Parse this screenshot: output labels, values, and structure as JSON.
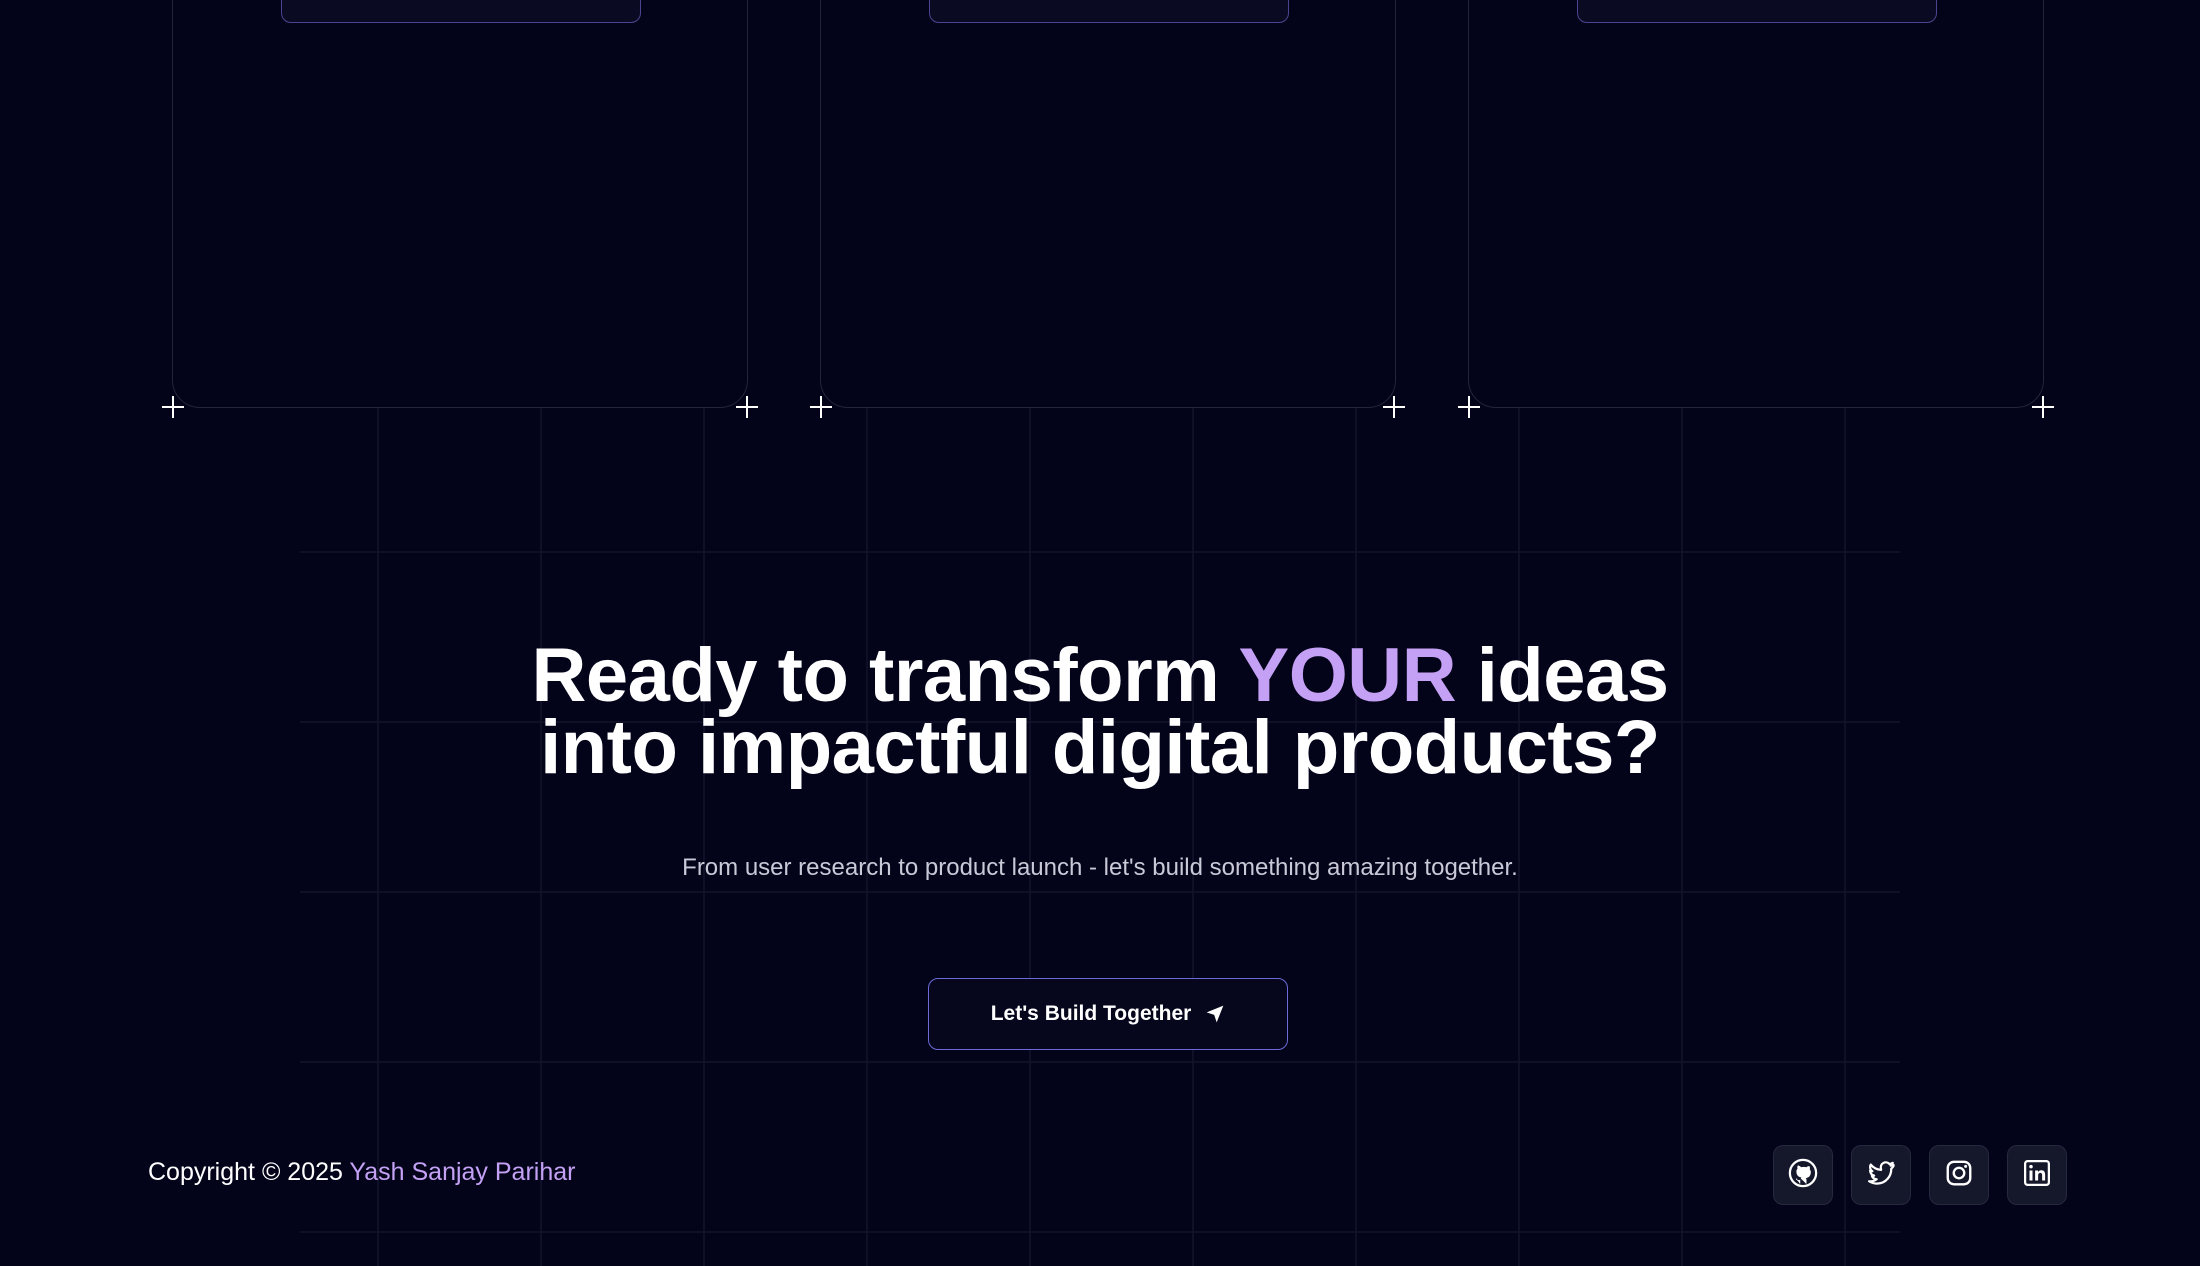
{
  "cta": {
    "headline_part1": "Ready to transform ",
    "headline_accent": "YOUR",
    "headline_part2": " ideas",
    "headline_line2": "into impactful digital products?",
    "subtitle": "From user research to product launch - let's build something amazing together.",
    "button_label": "Let's Build Together",
    "button_icon": "send-icon"
  },
  "footer": {
    "copyright_prefix": "Copyright © 2025 ",
    "author_name": "Yash Sanjay Parihar",
    "socials": [
      {
        "icon": "github-icon"
      },
      {
        "icon": "twitter-icon"
      },
      {
        "icon": "instagram-icon"
      },
      {
        "icon": "linkedin-icon"
      }
    ]
  },
  "colors": {
    "background": "#03041a",
    "accent": "#c4a1f5",
    "button_border": "#6b6ad8",
    "card_border": "#23253a"
  }
}
